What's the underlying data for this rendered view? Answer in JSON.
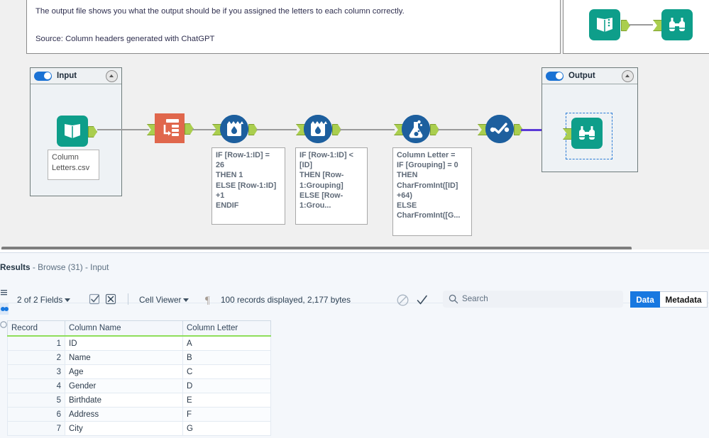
{
  "canvas": {
    "comment": {
      "line1": "The output file shows you what the output should be if you assigned the letters to each column correctly.",
      "line2": "Source: Column headers generated with ChatGPT"
    },
    "snippet": {
      "input_icon": "book-input-icon",
      "output_icon": "binoculars-browse-icon"
    },
    "input_container": {
      "title": "Input",
      "toggle_icon": "toggle-on-icon",
      "collapse_icon": "collapse-caret-icon",
      "node_label": "Column\nLetters.csv",
      "node_icon": "book-input-icon"
    },
    "output_container": {
      "title": "Output",
      "toggle_icon": "toggle-on-icon",
      "collapse_icon": "collapse-caret-icon",
      "node_icon": "binoculars-browse-icon"
    },
    "tools": [
      {
        "name": "record-id-tool",
        "icon": "record-id-icon",
        "annotation": ""
      },
      {
        "name": "multi-row-formula-1",
        "icon": "multi-row-formula-icon",
        "annotation": "IF [Row-1:ID] =\n26\nTHEN 1\nELSE [Row-1:ID]\n+1\nENDIF"
      },
      {
        "name": "multi-row-formula-2",
        "icon": "multi-row-formula-icon",
        "annotation": "IF [Row-1:ID] <\n[ID]\nTHEN [Row-\n1:Grouping]\nELSE [Row-\n1:Grou..."
      },
      {
        "name": "formula-tool",
        "icon": "formula-flask-icon",
        "annotation": "Column Letter =\nIF [Grouping] = 0\nTHEN\nCharFromInt([ID]\n+64)\nELSE\nCharFromInt([G..."
      },
      {
        "name": "select-tool",
        "icon": "select-check-icon",
        "annotation": ""
      }
    ]
  },
  "results": {
    "title_main": "Results",
    "title_sub": " - Browse (31) - Input",
    "toolbar": {
      "fields_label": "2 of 2 Fields",
      "select_all_icon": "checkbox-checked-icon",
      "deselect_all_icon": "checkbox-cross-icon",
      "cell_viewer_label": "Cell Viewer",
      "pilcrow_icon": "pilcrow-icon",
      "record_info": "100 records displayed, 2,177 bytes",
      "block_icon": "no-entry-icon",
      "check_icon": "checkmark-icon"
    },
    "search": {
      "placeholder": "Search",
      "icon": "search-icon"
    },
    "segments": {
      "data_label": "Data",
      "metadata_label": "Metadata",
      "active": "Data"
    },
    "table": {
      "columns": [
        "Record",
        "Column Name",
        "Column Letter"
      ],
      "rows": [
        {
          "record": "1",
          "name": "ID",
          "letter": "A"
        },
        {
          "record": "2",
          "name": "Name",
          "letter": "B"
        },
        {
          "record": "3",
          "name": "Age",
          "letter": "C"
        },
        {
          "record": "4",
          "name": "Gender",
          "letter": "D"
        },
        {
          "record": "5",
          "name": "Birthdate",
          "letter": "E"
        },
        {
          "record": "6",
          "name": "Address",
          "letter": "F"
        },
        {
          "record": "7",
          "name": "City",
          "letter": "G"
        }
      ]
    }
  },
  "colors": {
    "accent_blue": "#1878e0",
    "teal": "#0fa08c",
    "tool_blue": "#1d5f9e",
    "record_id_orange": "#e0674c",
    "anchor_green": "#aace4e",
    "header_underline_green": "#8ede5a",
    "wire_purple": "#5b39d6"
  }
}
